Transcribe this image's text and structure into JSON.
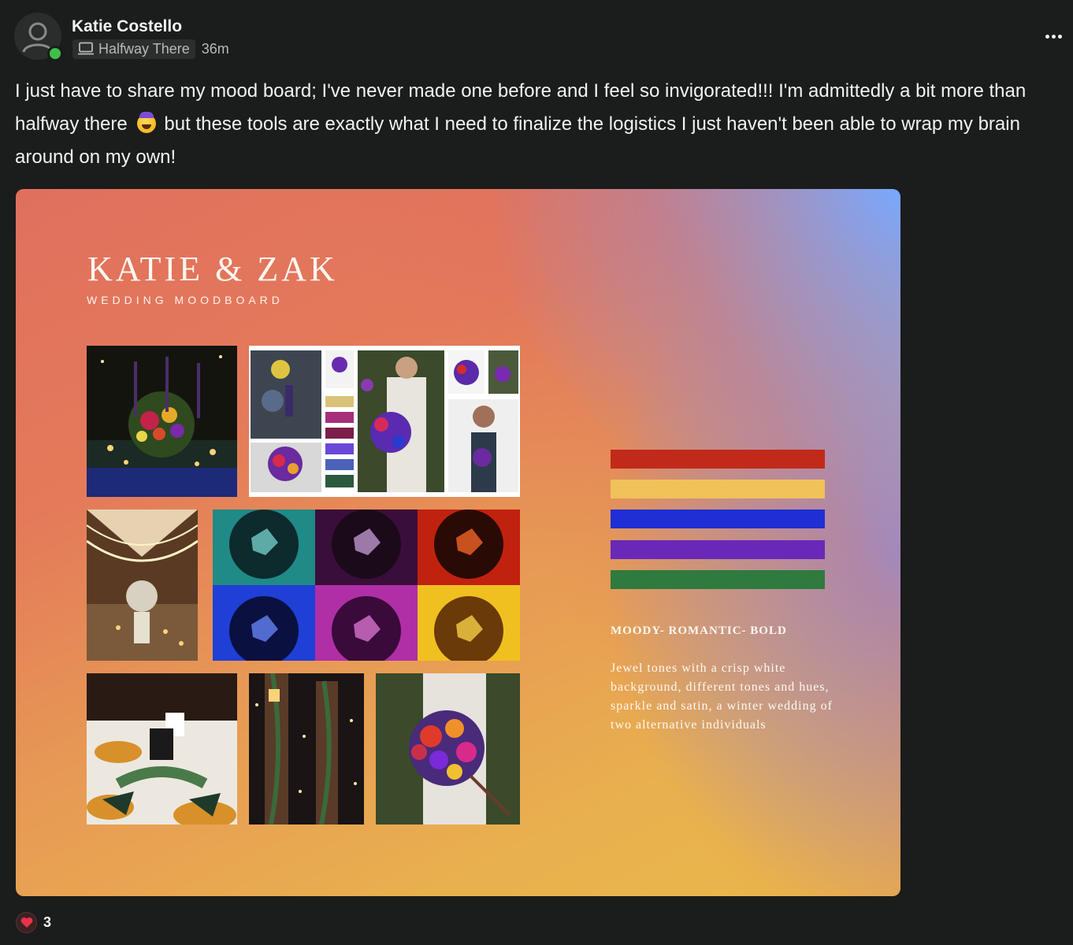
{
  "author": {
    "name": "Katie Costello",
    "level_label": "Halfway There",
    "time_ago": "36m",
    "online": true
  },
  "post": {
    "text_part1": "I just have to share my mood board; I've never made one before and I feel so invigorated!!! I'm admittedly a bit more than halfway there",
    "emoji": "star-struck-emoji",
    "text_part2": "but these tools are exactly what I need to finalize the logistics I just haven't been able to wrap my brain around on my own!"
  },
  "moodboard": {
    "title": "KATIE & ZAK",
    "subtitle": "WEDDING MOODBOARD",
    "swatches": [
      "#c12a1a",
      "#f0c25a",
      "#1f2fd4",
      "#6a28b8",
      "#2f7a3e"
    ],
    "heading": "MOODY- ROMANTIC- BOLD",
    "description": "Jewel tones with a crisp white background, different tones and hues, sparkle and satin, a winter wedding of two alternative individuals",
    "gem_colors": {
      "teal": "#1f8a86",
      "purple": "#3a0e3a",
      "red": "#c0220f",
      "blue": "#1f3fd6",
      "magenta": "#b02fa6",
      "gold": "#f0c020"
    }
  },
  "reactions": {
    "icon": "heart-icon",
    "count": "3"
  },
  "menu": {
    "icon": "more-options-icon"
  }
}
